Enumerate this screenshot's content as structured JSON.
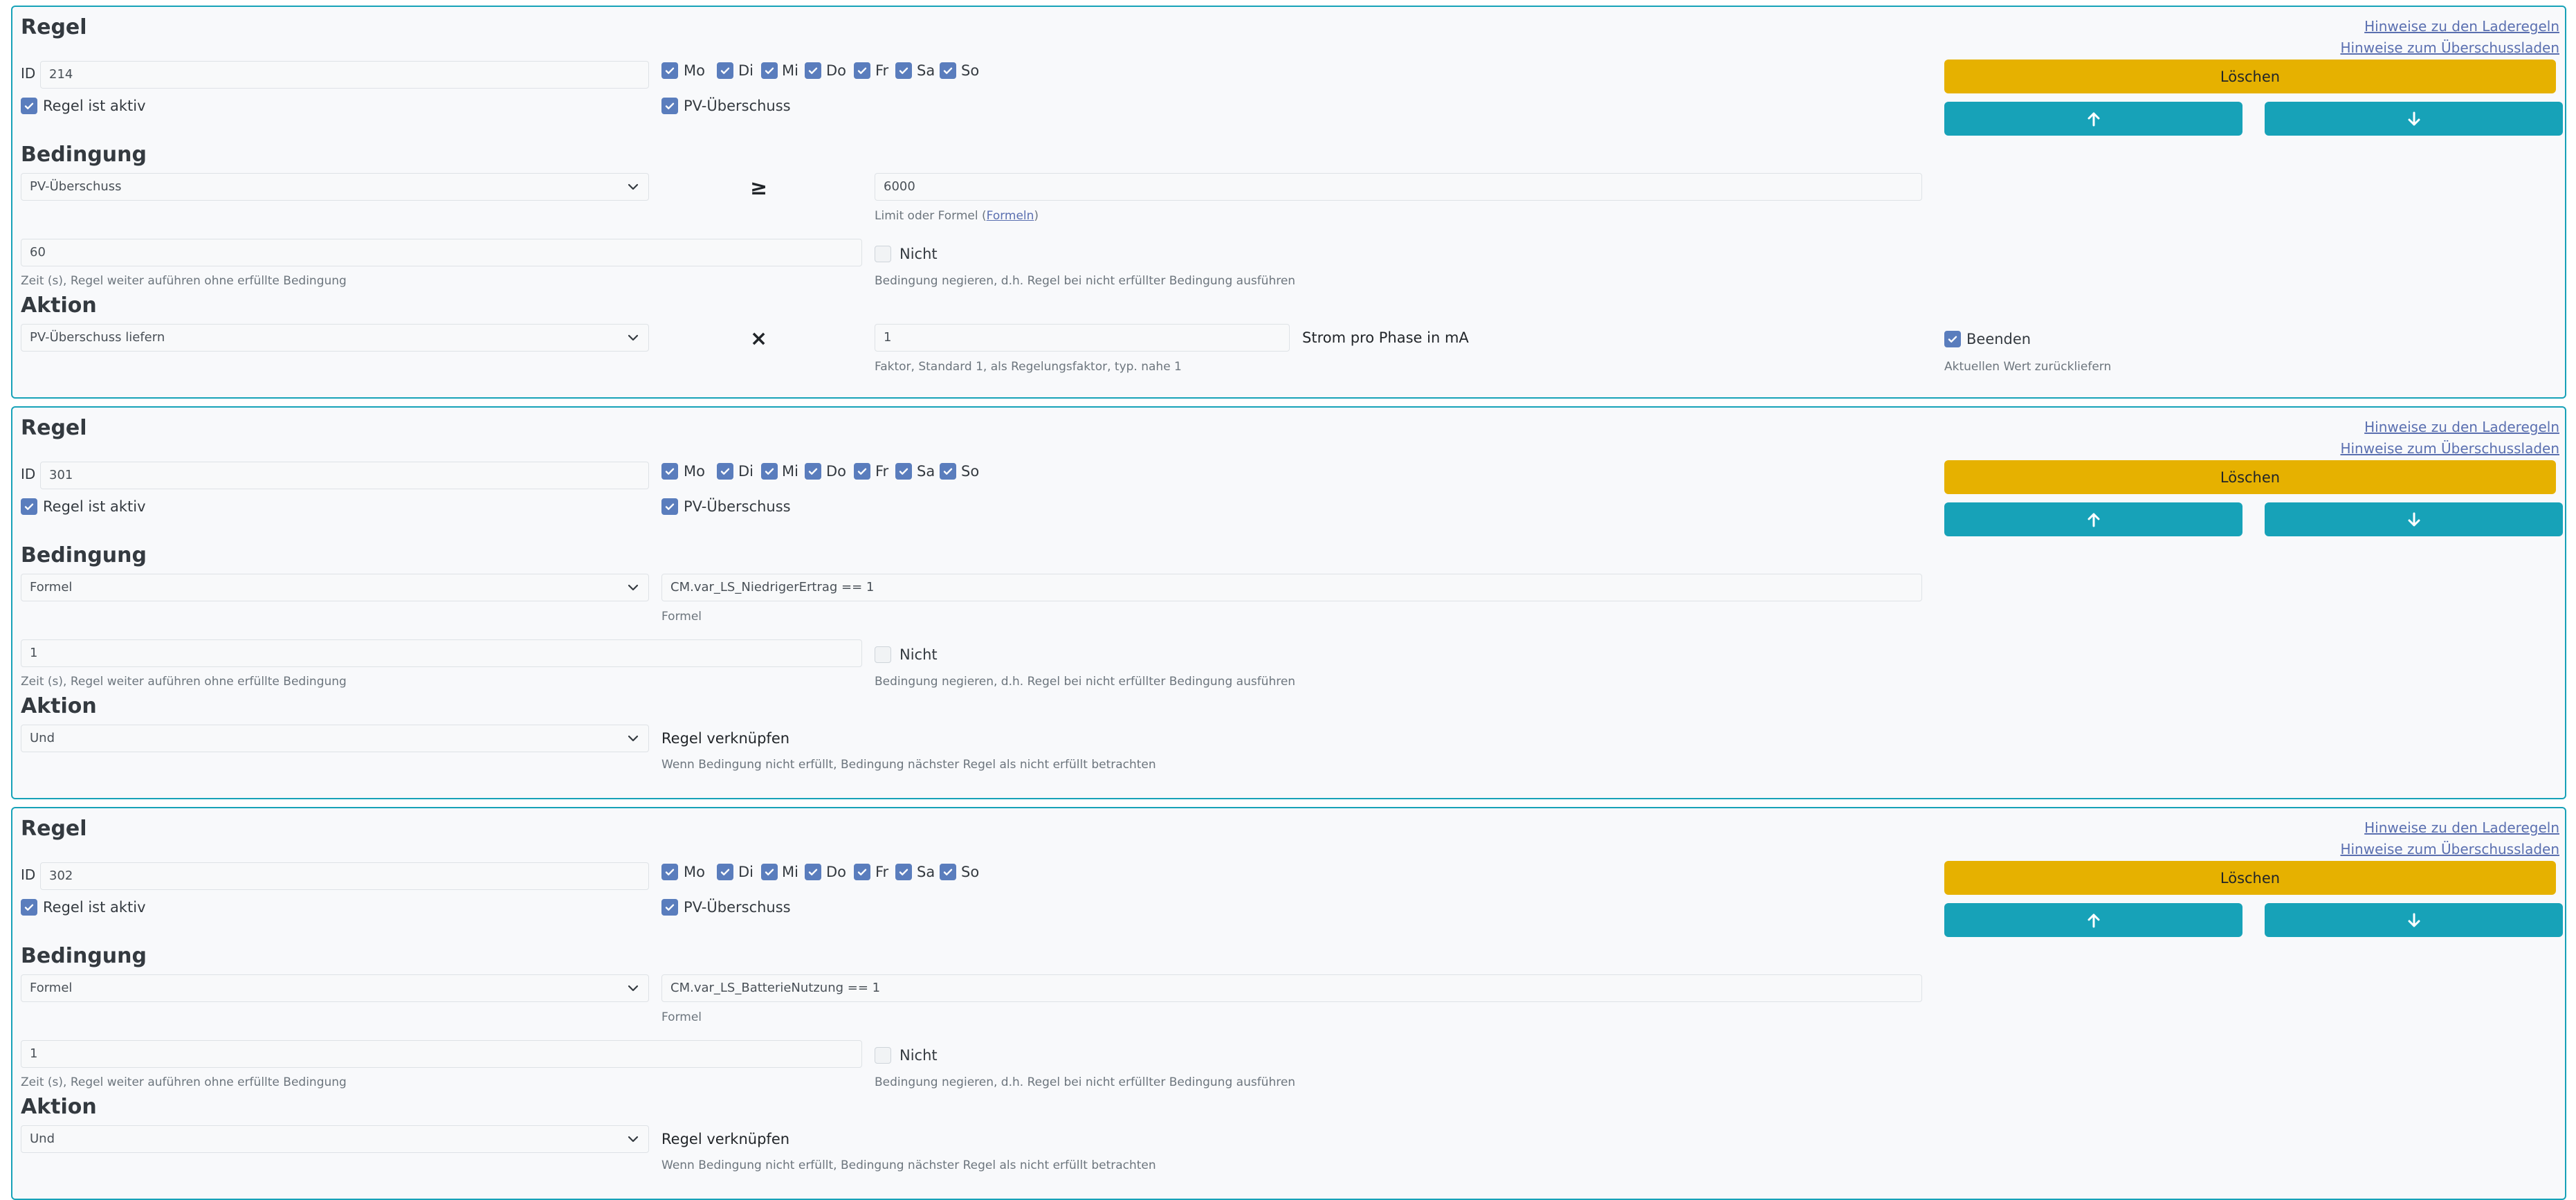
{
  "links": {
    "laderegeln": "Hinweise zu den Laderegeln",
    "ueberschuss": "Hinweise zum Überschussladen"
  },
  "labels": {
    "regel": "Regel",
    "id": "ID",
    "active": "Regel ist aktiv",
    "pv": "PV-Überschuss",
    "bedingung": "Bedingung",
    "aktion": "Aktion",
    "delete": "Löschen",
    "nicht": "Nicht",
    "time_help": "Zeit (s), Regel weiter auführen ohne erfüllte Bedingung",
    "negate_help": "Bedingung negieren, d.h. Regel bei nicht erfüllter Bedingung ausführen",
    "formel_help": "Formel"
  },
  "days": [
    "Mo",
    "Di",
    "Mi",
    "Do",
    "Fr",
    "Sa",
    "So"
  ],
  "rules": [
    {
      "id": "214",
      "condition": {
        "type": "PV-Überschuss",
        "operator": "≥",
        "limit": "6000",
        "limit_help_prefix": "Limit oder Formel (",
        "limit_help_link": "Formeln",
        "limit_help_suffix": ")"
      },
      "time": "60",
      "action": {
        "type": "PV-Überschuss liefern",
        "operator": "×",
        "factor": "1",
        "factor_help": "Faktor, Standard 1, als Regelungsfaktor, typ. nahe 1",
        "unit": "Strom pro Phase in mA",
        "beenden": "Beenden",
        "beenden_help": "Aktuellen Wert zurückliefern"
      }
    },
    {
      "id": "301",
      "condition": {
        "type": "Formel",
        "formula": "CM.var_LS_NiedrigerErtrag == 1"
      },
      "time": "1",
      "action": {
        "type": "Und",
        "title": "Regel verknüpfen",
        "help": "Wenn Bedingung nicht erfüllt, Bedingung nächster Regel als nicht erfüllt betrachten"
      }
    },
    {
      "id": "302",
      "condition": {
        "type": "Formel",
        "formula": "CM.var_LS_BatterieNutzung == 1"
      },
      "time": "1",
      "action": {
        "type": "Und",
        "title": "Regel verknüpfen",
        "help": "Wenn Bedingung nicht erfüllt, Bedingung nächster Regel als nicht erfüllt betrachten"
      }
    }
  ]
}
